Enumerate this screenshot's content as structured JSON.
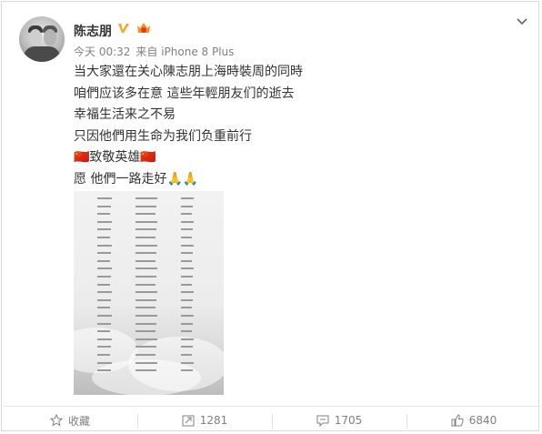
{
  "post": {
    "author": "陈志朋",
    "time": "今天 00:32",
    "source": "来自 iPhone 8 Plus",
    "lines": [
      "当大家還在关心陳志朋上海時裝周的同時",
      "咱們应该多在意 這些年輕朋友们的逝去",
      "幸福生活来之不易",
      "只因他們用生命为我们负重前行",
      "🇨🇳致敬英雄🇨🇳",
      "愿 他們一路走好🙏🙏"
    ]
  },
  "actions": {
    "favorite_label": "收藏",
    "repost_count": "1281",
    "comment_count": "1705",
    "like_count": "6840"
  },
  "colors": {
    "accent_verified": "#f5a623",
    "text": "#333333",
    "meta": "#808080"
  },
  "icons": [
    "chevron-down-icon",
    "verified-icon",
    "member-badge-icon",
    "star-icon",
    "repost-icon",
    "comment-icon",
    "like-icon"
  ]
}
